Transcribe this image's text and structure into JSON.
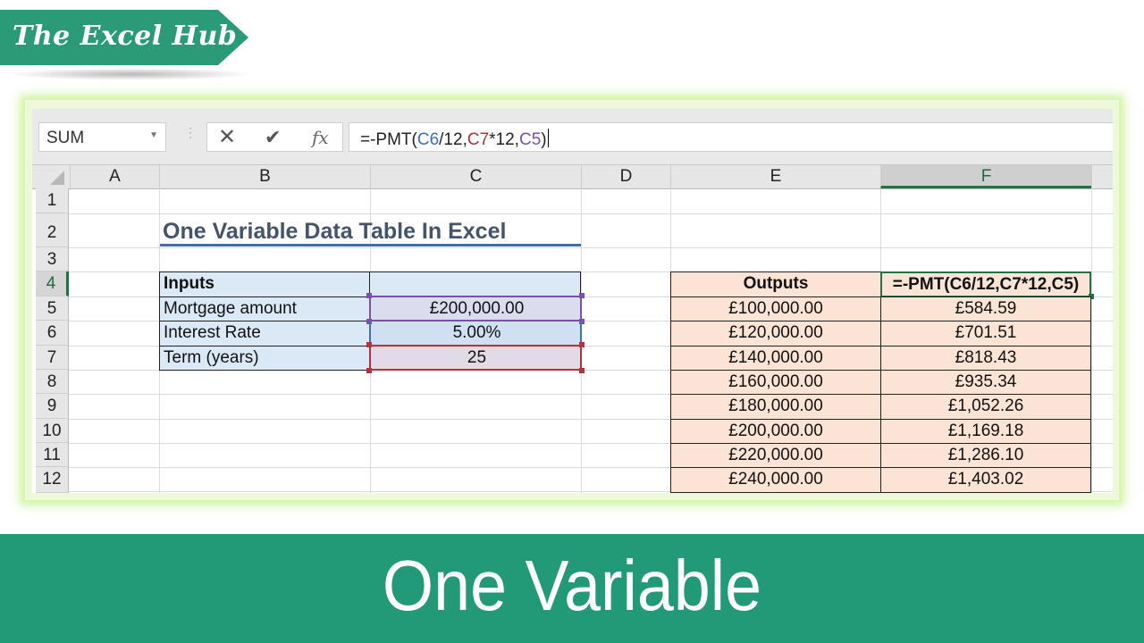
{
  "brand": {
    "name": "The Excel Hub",
    "color": "#2a9a77"
  },
  "formula_bar": {
    "name_box": "SUM",
    "cancel_icon": "✕",
    "enter_icon": "✔",
    "fx_icon": "fx",
    "formula_parts": {
      "p1": "=-PMT(",
      "r1": "C6",
      "p2": "/12,",
      "r2": "C7",
      "p3": "*12,",
      "r3": "C5",
      "p4": ")"
    }
  },
  "columns": [
    "A",
    "B",
    "C",
    "D",
    "E",
    "F"
  ],
  "active_column": "F",
  "rows": [
    "1",
    "2",
    "3",
    "4",
    "5",
    "6",
    "7",
    "8",
    "9",
    "10",
    "11",
    "12"
  ],
  "active_row": "4",
  "title": "One Variable Data Table In Excel",
  "inputs": {
    "header": "Inputs",
    "items": [
      {
        "label": "Mortgage amount",
        "value": "£200,000.00"
      },
      {
        "label": "Interest Rate",
        "value": "5.00%"
      },
      {
        "label": "Term (years)",
        "value": "25"
      }
    ]
  },
  "outputs": {
    "header": "Outputs",
    "formula_cell": "=-PMT(C6/12,C7*12,C5)",
    "rows": [
      {
        "amount": "£100,000.00",
        "payment": "£584.59"
      },
      {
        "amount": "£120,000.00",
        "payment": "£701.51"
      },
      {
        "amount": "£140,000.00",
        "payment": "£818.43"
      },
      {
        "amount": "£160,000.00",
        "payment": "£935.34"
      },
      {
        "amount": "£180,000.00",
        "payment": "£1,052.26"
      },
      {
        "amount": "£200,000.00",
        "payment": "£1,169.18"
      },
      {
        "amount": "£220,000.00",
        "payment": "£1,286.10"
      },
      {
        "amount": "£240,000.00",
        "payment": "£1,403.02"
      }
    ]
  },
  "colors": {
    "excel_green": "#217346",
    "input_fill": "#dbe8f5",
    "output_fill": "#fbe3d5",
    "ref_blue": "#3e6fb8",
    "ref_red": "#b8303a",
    "ref_purple": "#7b4fb0",
    "banner": "#229a78"
  },
  "banner": {
    "text": "One Variable"
  }
}
